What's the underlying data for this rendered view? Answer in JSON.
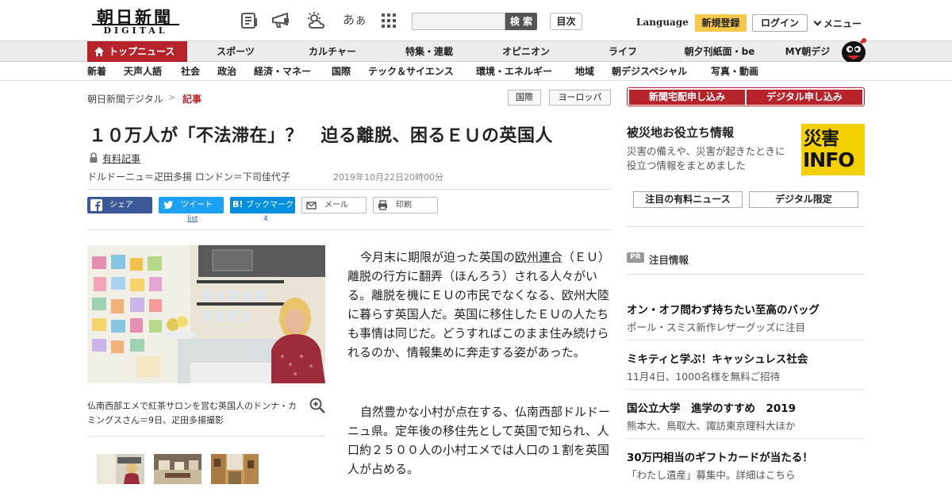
{
  "colors": {
    "brand_red": "#b7232b",
    "register_yellow": "#f6c94a",
    "disaster_yellow": "#f4d000"
  },
  "header": {
    "logo_main": "朝日新聞",
    "logo_sub": "DIGITAL",
    "icons": [
      "newspaper-icon",
      "megaphone-icon",
      "weather-icon",
      "font-size-icon",
      "grid-icon"
    ],
    "font_size_label": "あぁ",
    "search_placeholder": "",
    "search_label": "検 索",
    "toc_label": "目次",
    "language_label": "Language",
    "register_label": "新規登録",
    "login_label": "ログイン",
    "menu_label": "メニュー"
  },
  "nav": {
    "top_label": "トップニュース",
    "main": [
      "スポーツ",
      "カルチャー",
      "特集・連載",
      "オピニオン",
      "ライフ",
      "朝夕刊紙面・be",
      "MY朝デジ"
    ],
    "sub": [
      "新着",
      "天声人語",
      "社会",
      "政治",
      "経済・マネー",
      "国際",
      "テック＆サイエンス",
      "環境・エネルギー",
      "地域",
      "朝デジスペシャル",
      "写真・動画"
    ]
  },
  "breadcrumb": {
    "home": "朝日新聞デジタル",
    "separator": ">",
    "current": "記事"
  },
  "tags": [
    "国際",
    "ヨーロッパ"
  ],
  "article": {
    "title": "１０万人が「不法滞在」？　迫る離脱、困るＥＵの英国人",
    "paid_label": "有料記事",
    "byline": "ドルドーニュ＝疋田多揚 ロンドン＝下司佳代子",
    "date": "2019年10月22日20時00分",
    "share": {
      "facebook": "シェア",
      "twitter": "ツイート",
      "twitter_count": "list",
      "hatena": "ブックマーク",
      "hatena_count": "4",
      "mail": "メール",
      "print": "印刷"
    },
    "photo_caption": "仏南西部エメで紅茶サロンを営む英国人のドンナ・カミングスさん＝9日、疋田多揚撮影",
    "para1_prefix": "今月末に期限が迫った英国の",
    "para1_link": "欧州連合",
    "para1_rest": "（ＥＵ）離脱の行方に翻弄（ほんろう）される人々がいる。離脱を機にＥＵの市民でなくなる、欧州大陸に暮らす英国人だ。英国に移住したＥＵの人たちも事情は同じだ。どうすればこのまま住み続けられるのか、情報集めに奔走する姿があった。",
    "para2": "自然豊かな小村が点在する、仏南西部ドルドーニュ県。定年後の移住先として英国で知られ、人口約２５００人の小村エメでは人口の１割を英国人が占める。"
  },
  "sidebar": {
    "subscribe_paper": "新聞宅配申し込み",
    "subscribe_digital": "デジタル申し込み",
    "disaster_title": "被災地お役立ち情報",
    "disaster_desc": "災害の備えや、災害が起きたときに役立つ情報をまとめました",
    "disaster_logo_top": "災害",
    "disaster_logo_bottom": "INFO",
    "paid_news_button": "注目の有料ニュース",
    "digital_only_button": "デジタル限定",
    "pr_badge": "PR",
    "pr_heading": "注目情報",
    "pr_items": [
      {
        "title": "オン・オフ問わず持ちたい至高のバッグ",
        "sub": "ポール・スミス新作レザーグッズに注目"
      },
      {
        "title": "ミキティと学ぶ！キャッシュレス社会",
        "sub": "11月4日、1000名様を無料ご招待"
      },
      {
        "title": "国公立大学　進学のすすめ　2019",
        "sub": "熊本大、鳥取大、諏訪東京理科大ほか"
      },
      {
        "title": "30万円相当のギフトカードが当たる！",
        "sub": "「わたし遺産」募集中。詳細はこちら"
      }
    ]
  }
}
